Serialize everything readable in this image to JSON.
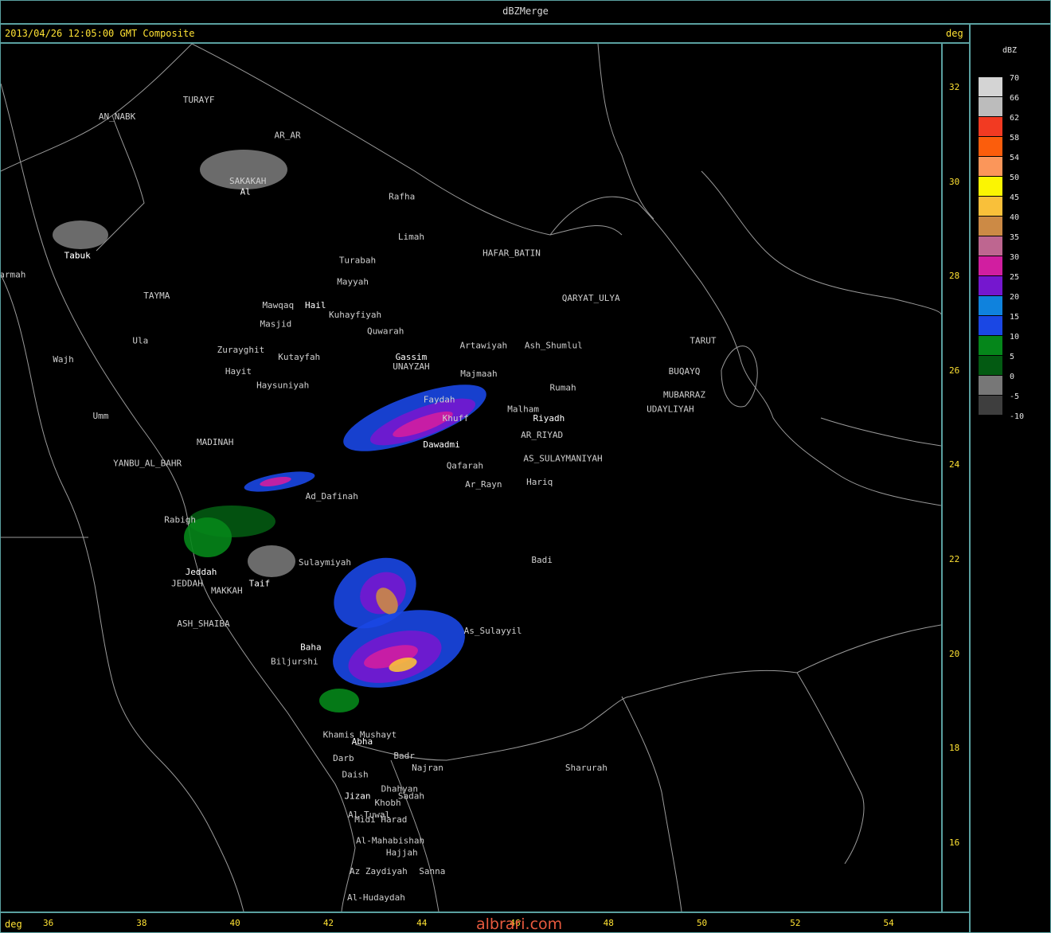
{
  "window": {
    "title": "dBZMerge"
  },
  "header": {
    "product_text": "2013/04/26 12:05:00 GMT Composite",
    "deg_label": "deg"
  },
  "footer": {
    "deg_label": "deg",
    "watermark": "albrari.com"
  },
  "legend": {
    "unit": "dBZ",
    "items": [
      {
        "label": "70",
        "color": "#d4d4d4"
      },
      {
        "label": "66",
        "color": "#bcbcbc"
      },
      {
        "label": "62",
        "color": "#f23a22"
      },
      {
        "label": "58",
        "color": "#fb5d0c"
      },
      {
        "label": "54",
        "color": "#fb965a"
      },
      {
        "label": "50",
        "color": "#fbf502"
      },
      {
        "label": "45",
        "color": "#f9c03a"
      },
      {
        "label": "40",
        "color": "#cc8a45"
      },
      {
        "label": "35",
        "color": "#be6690"
      },
      {
        "label": "30",
        "color": "#d11ea0"
      },
      {
        "label": "25",
        "color": "#7517cf"
      },
      {
        "label": "20",
        "color": "#0f82dd"
      },
      {
        "label": "15",
        "color": "#1a47e4"
      },
      {
        "label": "10",
        "color": "#05861a"
      },
      {
        "label": "5",
        "color": "#035a12"
      },
      {
        "label": "0",
        "color": "#777777"
      },
      {
        "label": "-5",
        "color": "#3e3e3e"
      },
      {
        "label": "-10",
        "color": ""
      }
    ]
  },
  "axes": {
    "lat_ticks": [
      "32",
      "30",
      "28",
      "26",
      "24",
      "22",
      "20",
      "18",
      "16"
    ],
    "lon_ticks": [
      "36",
      "38",
      "40",
      "42",
      "44",
      "46",
      "48",
      "50",
      "52",
      "54"
    ]
  },
  "cities": [
    {
      "name": "TURAYF",
      "lon": 39.2,
      "lat": 31.7
    },
    {
      "name": "AN_NABK",
      "lon": 37.45,
      "lat": 31.35
    },
    {
      "name": "AR_AR",
      "lon": 41.1,
      "lat": 30.95
    },
    {
      "name": "SAKAKAH",
      "lon": 40.25,
      "lat": 29.98
    },
    {
      "name": "Rafha",
      "lon": 43.55,
      "lat": 29.65
    },
    {
      "name": "Limah",
      "lon": 43.75,
      "lat": 28.8
    },
    {
      "name": "Tabuk",
      "lon": 36.6,
      "lat": 28.4
    },
    {
      "name": "HAFAR_BATIN",
      "lon": 45.9,
      "lat": 28.45
    },
    {
      "name": "Sharmah",
      "lon": 35.1,
      "lat": 28.0
    },
    {
      "name": "Turabah",
      "lon": 42.6,
      "lat": 28.3
    },
    {
      "name": "Mayyah",
      "lon": 42.5,
      "lat": 27.85
    },
    {
      "name": "TAYMA",
      "lon": 38.3,
      "lat": 27.55
    },
    {
      "name": "QARYAT_ULYA",
      "lon": 47.6,
      "lat": 27.5
    },
    {
      "name": "Mawqaq",
      "lon": 40.9,
      "lat": 27.35
    },
    {
      "name": "Kuhayfiyah",
      "lon": 42.55,
      "lat": 27.15
    },
    {
      "name": "Masjid",
      "lon": 40.85,
      "lat": 26.95
    },
    {
      "name": "Quwarah",
      "lon": 43.2,
      "lat": 26.8
    },
    {
      "name": "Ula",
      "lon": 37.95,
      "lat": 26.6
    },
    {
      "name": "Artawiyah",
      "lon": 45.3,
      "lat": 26.5
    },
    {
      "name": "Ash_Shumlul",
      "lon": 46.8,
      "lat": 26.5
    },
    {
      "name": "TARUT",
      "lon": 50.0,
      "lat": 26.6
    },
    {
      "name": "Zurayghit",
      "lon": 40.1,
      "lat": 26.4
    },
    {
      "name": "Kutayfah",
      "lon": 41.35,
      "lat": 26.25
    },
    {
      "name": "UNAYZAH",
      "lon": 43.75,
      "lat": 26.05
    },
    {
      "name": "Wajh",
      "lon": 36.3,
      "lat": 26.2
    },
    {
      "name": "Hayit",
      "lon": 40.05,
      "lat": 25.95
    },
    {
      "name": "Majmaah",
      "lon": 45.2,
      "lat": 25.9
    },
    {
      "name": "BUQAYQ",
      "lon": 49.6,
      "lat": 25.95
    },
    {
      "name": "Haysuniyah",
      "lon": 41.0,
      "lat": 25.65
    },
    {
      "name": "Rumah",
      "lon": 47.0,
      "lat": 25.6
    },
    {
      "name": "MUBARRAZ",
      "lon": 49.6,
      "lat": 25.45
    },
    {
      "name": "Faydah",
      "lon": 44.35,
      "lat": 25.35
    },
    {
      "name": "Malham",
      "lon": 46.15,
      "lat": 25.15
    },
    {
      "name": "UDAYLIYAH",
      "lon": 49.3,
      "lat": 25.15
    },
    {
      "name": "Umm",
      "lon": 37.1,
      "lat": 25.0
    },
    {
      "name": "Khuff",
      "lon": 44.7,
      "lat": 24.95
    },
    {
      "name": "AR_RIYAD",
      "lon": 46.55,
      "lat": 24.6
    },
    {
      "name": "MADINAH",
      "lon": 39.55,
      "lat": 24.45
    },
    {
      "name": "AS_SULAYMANIYAH",
      "lon": 47.0,
      "lat": 24.1
    },
    {
      "name": "YANBU_AL_BAHR",
      "lon": 38.1,
      "lat": 24.0
    },
    {
      "name": "Qafarah",
      "lon": 44.9,
      "lat": 23.95
    },
    {
      "name": "Hariq",
      "lon": 46.5,
      "lat": 23.6
    },
    {
      "name": "Ar_Rayn",
      "lon": 45.3,
      "lat": 23.55
    },
    {
      "name": "Ad_Dafinah",
      "lon": 42.05,
      "lat": 23.3
    },
    {
      "name": "Rabigh",
      "lon": 38.8,
      "lat": 22.8
    },
    {
      "name": "Badi",
      "lon": 46.55,
      "lat": 21.95
    },
    {
      "name": "Sulaymiyah",
      "lon": 41.9,
      "lat": 21.9
    },
    {
      "name": "JEDDAH",
      "lon": 38.95,
      "lat": 21.45
    },
    {
      "name": "MAKKAH",
      "lon": 39.8,
      "lat": 21.3
    },
    {
      "name": "ASH_SHAIBA",
      "lon": 39.3,
      "lat": 20.6
    },
    {
      "name": "As_Sulayyil",
      "lon": 45.5,
      "lat": 20.45
    },
    {
      "name": "Biljurshi",
      "lon": 41.25,
      "lat": 19.8
    },
    {
      "name": "Khamis Mushayt",
      "lon": 42.65,
      "lat": 18.25
    },
    {
      "name": "Badr",
      "lon": 43.6,
      "lat": 17.8
    },
    {
      "name": "Darb",
      "lon": 42.3,
      "lat": 17.75
    },
    {
      "name": "Najran",
      "lon": 44.1,
      "lat": 17.55
    },
    {
      "name": "Sharurah",
      "lon": 47.5,
      "lat": 17.55
    },
    {
      "name": "Daish",
      "lon": 42.55,
      "lat": 17.4
    },
    {
      "name": "Dhahyan",
      "lon": 43.5,
      "lat": 17.1
    },
    {
      "name": "Sadah",
      "lon": 43.75,
      "lat": 16.95
    },
    {
      "name": "Khobh",
      "lon": 43.25,
      "lat": 16.8
    },
    {
      "name": "Al-Tuwal",
      "lon": 42.85,
      "lat": 16.55
    },
    {
      "name": "Midi Harad",
      "lon": 43.1,
      "lat": 16.45
    },
    {
      "name": "Al-Mahabishah",
      "lon": 43.3,
      "lat": 16.0
    },
    {
      "name": "Hajjah",
      "lon": 43.55,
      "lat": 15.75
    },
    {
      "name": "Az Zaydiyah",
      "lon": 43.05,
      "lat": 15.35
    },
    {
      "name": "Sanna",
      "lon": 44.2,
      "lat": 15.35
    },
    {
      "name": "Al-Hudaydah",
      "lon": 43.0,
      "lat": 14.8
    }
  ],
  "radar_sites": [
    {
      "name": "Al",
      "lon": 40.2,
      "lat": 29.75
    },
    {
      "name": "Tabuk",
      "lon": 36.6,
      "lat": 28.4
    },
    {
      "name": "Hail",
      "lon": 41.7,
      "lat": 27.35
    },
    {
      "name": "Gassim",
      "lon": 43.75,
      "lat": 26.25
    },
    {
      "name": "Riyadh",
      "lon": 46.7,
      "lat": 24.95
    },
    {
      "name": "Dawadmi",
      "lon": 44.4,
      "lat": 24.4
    },
    {
      "name": "Jeddah",
      "lon": 39.25,
      "lat": 21.7
    },
    {
      "name": "Taif",
      "lon": 40.5,
      "lat": 21.45
    },
    {
      "name": "Baha",
      "lon": 41.6,
      "lat": 20.1
    },
    {
      "name": "Abha",
      "lon": 42.7,
      "lat": 18.1
    },
    {
      "name": "Jizan",
      "lon": 42.6,
      "lat": 16.95
    }
  ]
}
